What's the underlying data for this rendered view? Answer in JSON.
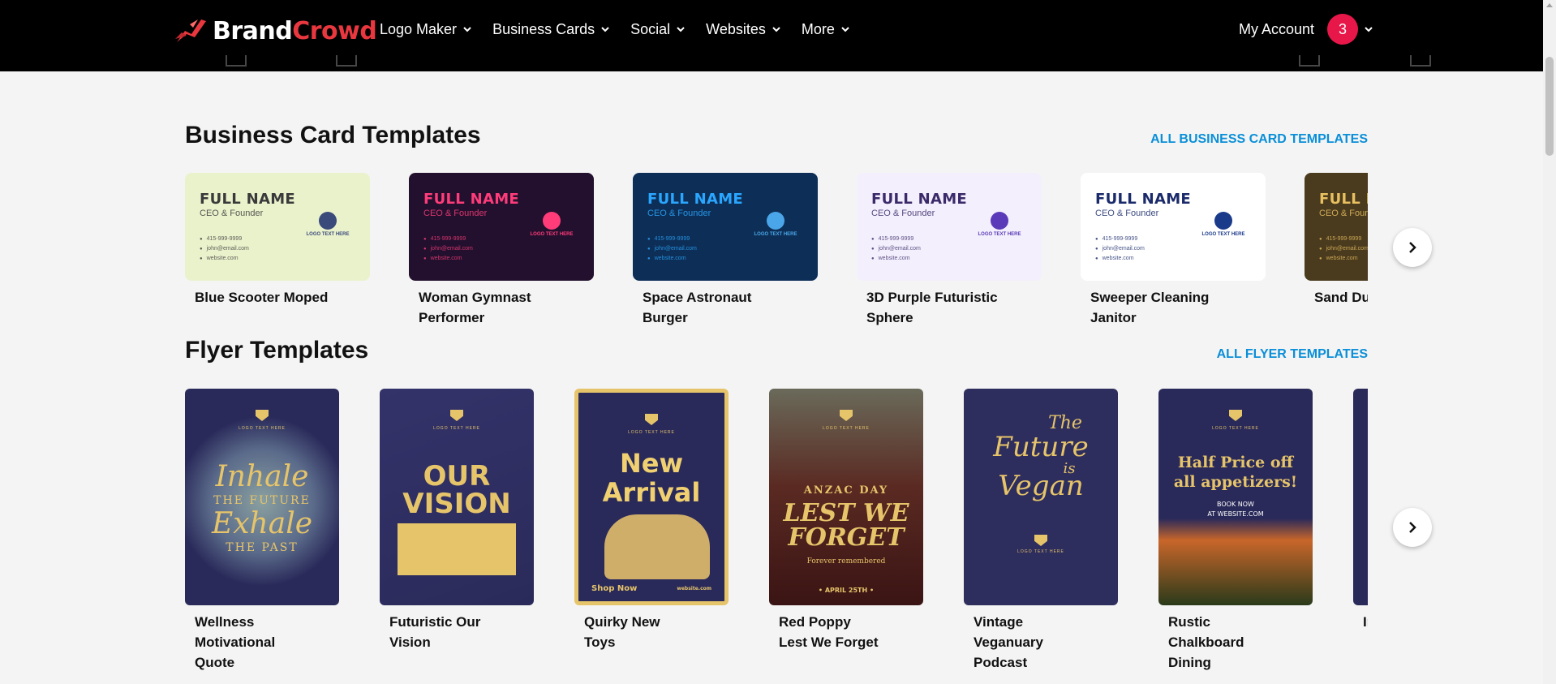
{
  "header": {
    "logo_brand": "Brand",
    "logo_crowd": "Crowd",
    "nav": [
      {
        "label": "Logo Maker"
      },
      {
        "label": "Business Cards"
      },
      {
        "label": "Social"
      },
      {
        "label": "Websites"
      },
      {
        "label": "More"
      }
    ],
    "account_label": "My Account",
    "notification_count": "3"
  },
  "business_cards": {
    "title": "Business Card Templates",
    "all_link": "ALL BUSINESS CARD TEMPLATES",
    "card_text": {
      "full_name": "FULL NAME",
      "role": "CEO & Founder",
      "phone": "415-999-9999",
      "email": "john@email.com",
      "website": "website.com",
      "logo_text": "LOGO TEXT HERE"
    },
    "items": [
      {
        "name": "Blue Scooter Moped",
        "bg": "#eaf2cc",
        "fg": "#3a3a3a",
        "accent": "#3a4a7a"
      },
      {
        "name": "Woman Gymnast Performer",
        "bg": "#22102e",
        "fg": "#ff3c7a",
        "accent": "#ff3c7a"
      },
      {
        "name": "Space Astronaut Burger",
        "bg": "#0d2f57",
        "fg": "#2aa6ff",
        "accent": "#4aa6e8"
      },
      {
        "name": "3D Purple Futuristic Sphere",
        "bg": "#f3effc",
        "fg": "#3a2a6a",
        "accent": "#5a3ab8"
      },
      {
        "name": "Sweeper Cleaning Janitor",
        "bg": "#ffffff",
        "fg": "#1a2a6a",
        "accent": "#1a3a8a"
      },
      {
        "name": "Sand Du",
        "bg": "#4a3a1e",
        "fg": "#e8c060",
        "accent": "#e8c060"
      }
    ]
  },
  "flyers": {
    "title": "Flyer Templates",
    "all_link": "ALL FLYER TEMPLATES",
    "logo_text": "LOGO TEXT HERE",
    "items": [
      {
        "name": "Wellness Motivational Quote",
        "line1": "Inhale",
        "line2": "THE FUTURE",
        "line3": "Exhale",
        "line4": "THE PAST"
      },
      {
        "name": "Futuristic Our Vision",
        "line1": "OUR",
        "line2": "VISION"
      },
      {
        "name": "Quirky New Toys",
        "line1": "New",
        "line2": "Arrival",
        "line3": "Shop Now",
        "line4": "website.com"
      },
      {
        "name": "Red Poppy Lest We Forget",
        "line1": "ANZAC DAY",
        "line2": "LEST WE",
        "line3": "FORGET",
        "line4": "Forever remembered",
        "line5": "• APRIL 25TH •"
      },
      {
        "name": "Vintage Veganuary Podcast",
        "line1": "The",
        "line2": "Future",
        "line3": "is",
        "line4": "Vegan"
      },
      {
        "name": "Rustic Chalkboard Dining",
        "line1": "Half Price off",
        "line2": "all appetizers!",
        "line3": "BOOK NOW",
        "line4": "AT WEBSITE.COM"
      },
      {
        "name": "In Fa G"
      }
    ]
  },
  "colors": {
    "header_bg": "#000000",
    "accent_red": "#e8373e",
    "badge": "#e8174a",
    "link_blue": "#0a8fd8",
    "flyer_gold": "#e6c46a",
    "flyer_navy": "#2a2a5a"
  }
}
